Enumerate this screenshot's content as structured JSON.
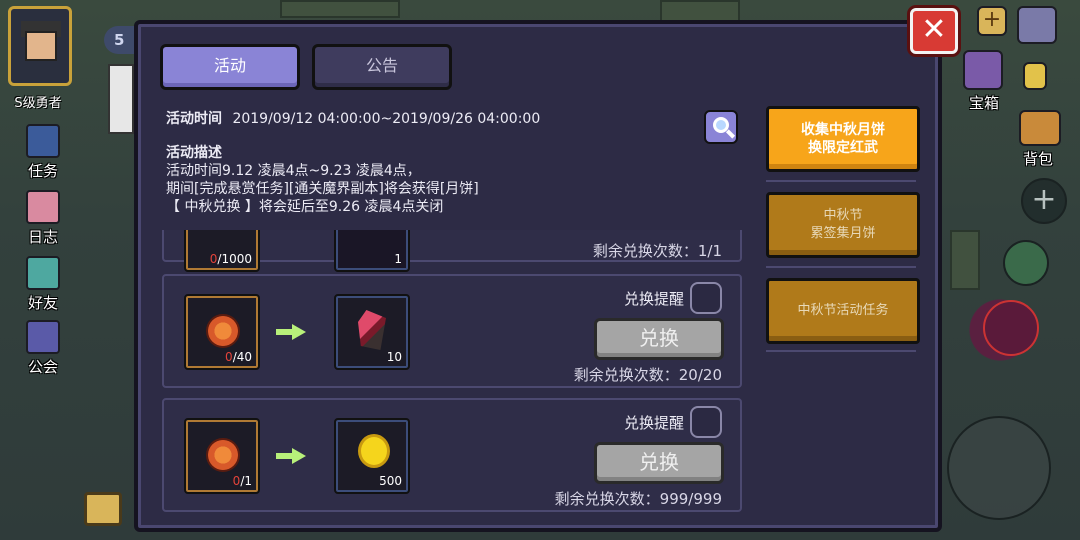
{
  "hud": {
    "level": "5",
    "rank_label": "S级勇者",
    "left_buttons": [
      {
        "label": "任务",
        "icon": "quest-icon"
      },
      {
        "label": "日志",
        "icon": "log-icon"
      },
      {
        "label": "好友",
        "icon": "friends-icon"
      },
      {
        "label": "公会",
        "icon": "guild-icon"
      }
    ],
    "right_labels": {
      "chest": "宝箱",
      "bag": "背包"
    }
  },
  "dialog": {
    "tabs": [
      {
        "label": "活动",
        "active": true
      },
      {
        "label": "公告",
        "active": false
      }
    ],
    "info": {
      "time_label": "活动时间",
      "time_value": "2019/09/12 04:00:00~2019/09/26 04:00:00",
      "desc_label": "活动描述",
      "desc_lines": [
        "活动时间9.12 凌晨4点~9.23 凌晨4点，",
        "期间[完成悬赏任务][通关魔界副本]将会获得[月饼]",
        "【 中秋兑换 】将会延后至9.26 凌晨4点关闭"
      ]
    },
    "exchanges": [
      {
        "src_have": "0",
        "src_need": "/1000",
        "dst_count": "1",
        "remain_text": "剩余兑换次数：1/1"
      },
      {
        "src_item": "mooncake-icon",
        "src_have": "0",
        "src_need": "/40",
        "dst_item": "red-crystal-icon",
        "dst_count": "10",
        "remind_label": "兑换提醒",
        "button_label": "兑换",
        "remain_text": "剩余兑换次数：20/20"
      },
      {
        "src_item": "mooncake-icon",
        "src_have": "0",
        "src_need": "/1",
        "dst_item": "gold-coin-icon",
        "dst_count": "500",
        "remind_label": "兑换提醒",
        "button_label": "兑换",
        "remain_text": "剩余兑换次数：999/999"
      }
    ],
    "side_menu": [
      {
        "line1": "收集中秋月饼",
        "line2": "换限定红武",
        "active": true
      },
      {
        "line1": "中秋节",
        "line2": "累签集月饼",
        "active": false
      },
      {
        "line1": "中秋节活动任务",
        "line2": "",
        "active": false
      }
    ],
    "close_glyph": "✕"
  },
  "colors": {
    "panel": "#2d2b45",
    "tab_active": "#8a84d6",
    "side_active": "#f7a51a",
    "side_inactive": "#b07a1a",
    "close": "#d83a34",
    "button_disabled": "#a5a5a5"
  }
}
